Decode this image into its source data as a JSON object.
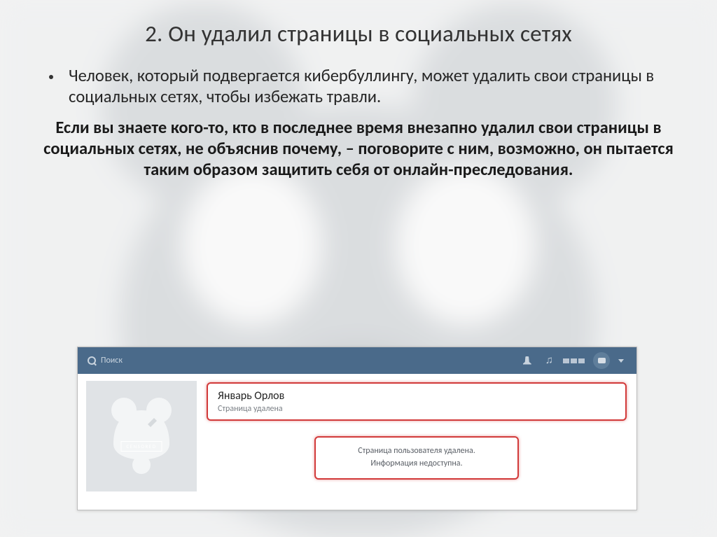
{
  "slide": {
    "title": "2. Он удалил страницы в социальных сетях",
    "paragraph1": "Человек, который подвергается кибербуллингу, может удалить свои страницы в социальных сетях, чтобы избежать травли.",
    "paragraph2": "Если вы знаете кого-то, кто в последнее время внезапно удалил свои страницы в социальных сетях, не объяснив почему, – поговорите с ним, возможно, он пытается таким образом защитить себя от онлайн-преследования."
  },
  "vk": {
    "search_placeholder": "Поиск",
    "avatar_label": "CENSORED",
    "profile_name": "Январь Орлов",
    "profile_status": "Страница удалена",
    "deleted_line1": "Страница пользователя удалена.",
    "deleted_line2": "Информация недоступна."
  }
}
